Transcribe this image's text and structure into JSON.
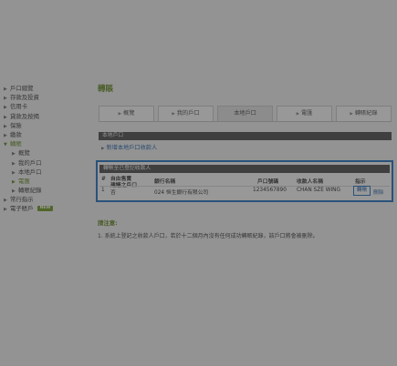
{
  "sidebar": {
    "items": [
      {
        "label": "戶口總覽"
      },
      {
        "label": "存款及投資"
      },
      {
        "label": "信用卡"
      },
      {
        "label": "貸款及按揭"
      },
      {
        "label": "保險"
      },
      {
        "label": "繳款"
      },
      {
        "label": "轉賬"
      }
    ],
    "sub_items": [
      {
        "label": "概覽"
      },
      {
        "label": "我的戶口"
      },
      {
        "label": "本地戶口"
      },
      {
        "label": "電匯"
      },
      {
        "label": "轉賬紀錄"
      }
    ],
    "bottom_items": [
      {
        "label": "常行指示"
      },
      {
        "label": "電子賬戶"
      }
    ],
    "new_badge": "NEW"
  },
  "page": {
    "title": "轉賬"
  },
  "tabs": [
    {
      "label": "概覽"
    },
    {
      "label": "我的戶口"
    },
    {
      "label": "本地戶口"
    },
    {
      "label": "電匯"
    },
    {
      "label": "轉賬紀錄"
    }
  ],
  "section": {
    "title": "本地戶口",
    "new_link": "新增本地戶口收款人"
  },
  "panel": {
    "title": "轉賬至已登記收款人",
    "headers": {
      "num": "#",
      "registered_1": "自由售賣",
      "registered_2": "建議之戶口",
      "bank": "銀行名稱",
      "account": "戶口號碼",
      "payee": "收款人名稱",
      "action": "指示"
    },
    "row": {
      "num": "1",
      "registered": "否",
      "bank": "024 恒生銀行有限公司",
      "account": "1234567890",
      "payee": "CHAN SZE WING",
      "transfer": "轉賬",
      "delete": "刪除"
    }
  },
  "notes": {
    "title": "請注意:",
    "items": [
      "1. 系統上登記之收款人戶口，若於十二個月內沒有任何成功轉賬紀錄，該戶口將會被刪除。"
    ]
  }
}
